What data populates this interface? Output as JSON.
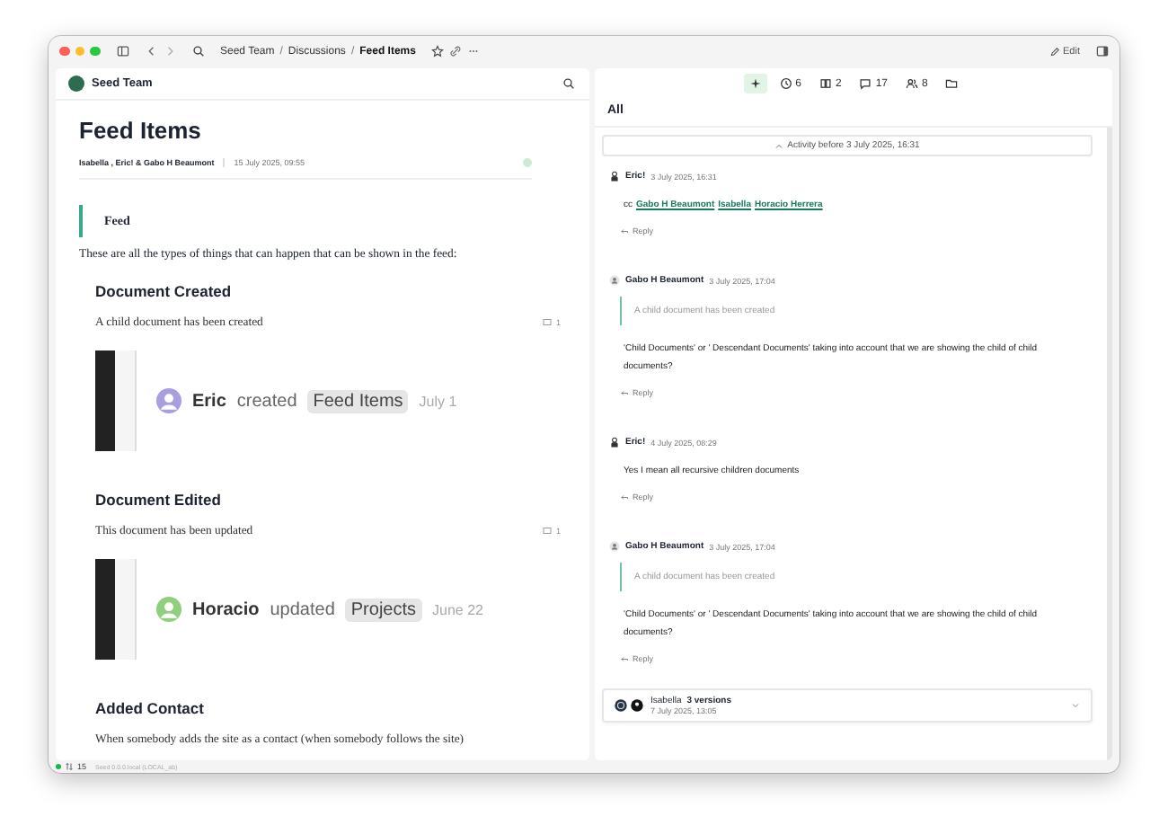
{
  "window": {
    "breadcrumb": [
      {
        "label": "Seed Team",
        "current": false
      },
      {
        "label": "Discussions",
        "current": false
      },
      {
        "label": "Feed Items",
        "current": true
      }
    ],
    "separator": "/",
    "edit": "Edit"
  },
  "sidebar_header": {
    "title": "Seed Team"
  },
  "document": {
    "title": "Feed Items",
    "authors": "Isabella , Eric! & Gabo H Beaumont",
    "date": "15 July 2025, 09:55",
    "blockquote": "Feed",
    "intro": "These are all the types of things that can happen that can be shown in the feed:",
    "sections": [
      {
        "heading": "Document Created",
        "description": "A child document has been created",
        "comment_count": "1",
        "embed": {
          "user": "Eric",
          "action": "created",
          "target": "Feed Items",
          "date": "July 1",
          "color": "#a89ee0"
        }
      },
      {
        "heading": "Document Edited",
        "description": "This document has been updated",
        "comment_count": "1",
        "embed": {
          "user": "Horacio",
          "action": "updated",
          "target": "Projects",
          "date": "June 22",
          "color": "#8fcf7e"
        }
      },
      {
        "heading": "Added Contact",
        "description": "When somebody adds the site as a contact (when somebody follows the site)"
      }
    ]
  },
  "panel": {
    "toolbar": [
      {
        "kind": "sparkle",
        "selected": true
      },
      {
        "kind": "clock",
        "count": "6",
        "selected": false
      },
      {
        "kind": "citations",
        "count": "2",
        "selected": false
      },
      {
        "kind": "comments",
        "count": "17",
        "selected": false
      },
      {
        "kind": "people",
        "count": "8",
        "selected": false
      },
      {
        "kind": "folder",
        "selected": false
      }
    ],
    "tab": "All",
    "activity_banner": "Activity before 3 July 2025, 16:31",
    "comments": [
      {
        "author": "Eric!",
        "kind": "person",
        "time": "3 July 2025, 16:31",
        "prefix": "cc",
        "mentions": [
          "Gabo H Beaumont",
          "Isabella",
          "Horacio Herrera"
        ],
        "reply": "Reply"
      },
      {
        "author": "Gabo H Beaumont",
        "kind": "round",
        "time": "3 July 2025, 17:04",
        "quote": "A child document has been created",
        "body": "'Child Documents' or ' Descendant Documents' taking into account that we are showing the child of child documents?",
        "reply": "Reply"
      },
      {
        "author": "Eric!",
        "kind": "person",
        "time": "4 July 2025, 08:29",
        "body": "Yes I mean all recursive children documents",
        "reply": "Reply"
      },
      {
        "author": "Gabo H Beaumont",
        "kind": "round",
        "time": "3 July 2025, 17:04",
        "quote": "A child document has been created",
        "body": "'Child Documents' or ' Descendant Documents' taking into account that we are showing the child of child documents?",
        "reply": "Reply"
      }
    ],
    "version_card": {
      "author": "Isabella",
      "versions": "3 versions",
      "time": "7 July 2025, 13:05"
    }
  },
  "status_bar": {
    "count": "15",
    "version": "Seed 0.0.0.local (LOCAL_ab)"
  }
}
